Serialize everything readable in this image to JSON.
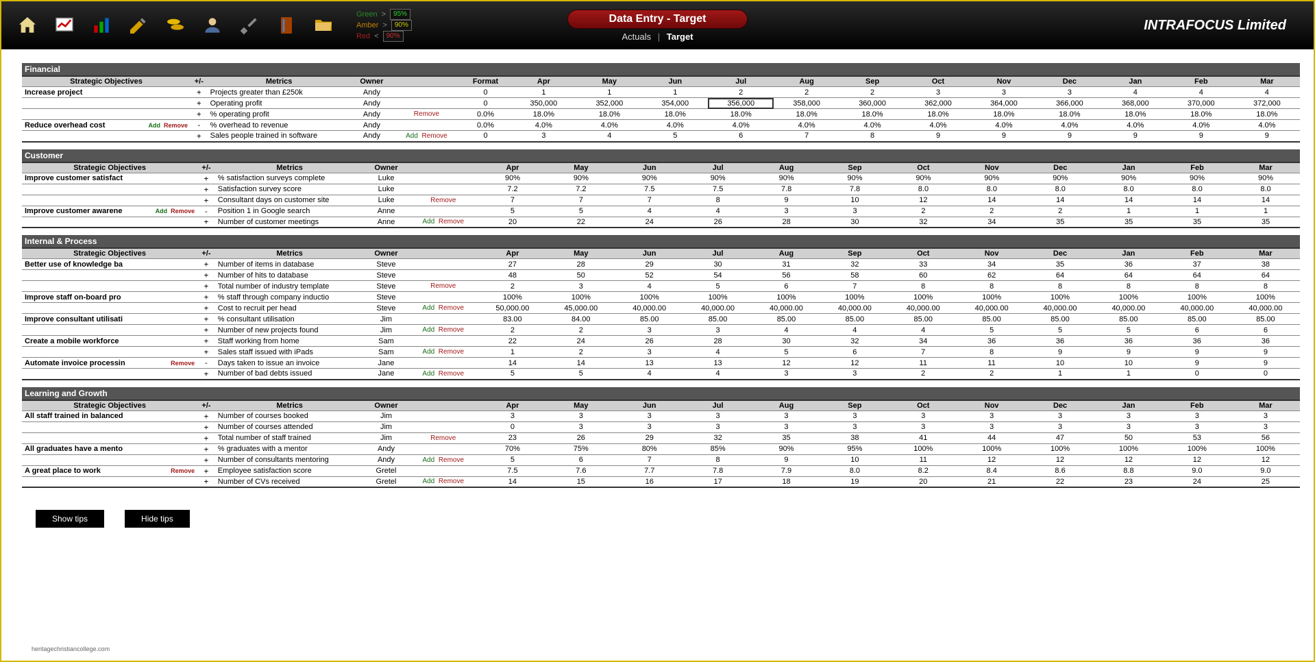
{
  "header": {
    "title": "Data Entry - Target",
    "tab_actuals": "Actuals",
    "tab_target": "Target",
    "company": "INTRAFOCUS Limited",
    "legend": {
      "green_label": "Green",
      "green_op": ">",
      "green_val": "95%",
      "amber_label": "Amber",
      "amber_op": ">",
      "amber_val": "90%",
      "red_label": "Red",
      "red_op": "<",
      "red_val": "90%"
    }
  },
  "buttons": {
    "show_tips": "Show tips",
    "hide_tips": "Hide tips"
  },
  "watermark": "heritagechristiancollege.com",
  "columns": {
    "strategic_objectives": "Strategic Objectives",
    "plus_minus": "+/-",
    "metrics": "Metrics",
    "owner": "Owner",
    "format": "Format",
    "months": [
      "Apr",
      "May",
      "Jun",
      "Jul",
      "Aug",
      "Sep",
      "Oct",
      "Nov",
      "Dec",
      "Jan",
      "Feb",
      "Mar"
    ]
  },
  "labels": {
    "add": "Add",
    "remove": "Remove"
  },
  "selected": {
    "section": 0,
    "row": 1,
    "col": 3
  },
  "sections": [
    {
      "name": "Financial",
      "objectives": [
        {
          "name": "Increase project",
          "obj_actions": "",
          "rows": [
            {
              "pm": "+",
              "metric": "Projects greater than £250k",
              "owner": "Andy",
              "actions": "",
              "format": "0",
              "values": [
                "1",
                "1",
                "1",
                "2",
                "2",
                "2",
                "3",
                "3",
                "3",
                "4",
                "4",
                "4"
              ]
            },
            {
              "pm": "+",
              "metric": "Operating profit",
              "owner": "Andy",
              "actions": "",
              "format": "0",
              "values": [
                "350,000",
                "352,000",
                "354,000",
                "356,000",
                "358,000",
                "360,000",
                "362,000",
                "364,000",
                "366,000",
                "368,000",
                "370,000",
                "372,000"
              ]
            },
            {
              "pm": "+",
              "metric": "% operating profit",
              "owner": "Andy",
              "actions": "Remove",
              "format": "0.0%",
              "values": [
                "18.0%",
                "18.0%",
                "18.0%",
                "18.0%",
                "18.0%",
                "18.0%",
                "18.0%",
                "18.0%",
                "18.0%",
                "18.0%",
                "18.0%",
                "18.0%"
              ]
            }
          ]
        },
        {
          "name": "Reduce overhead cost",
          "obj_actions": "Add Remove",
          "rows": [
            {
              "pm": "-",
              "metric": "% overhead to revenue",
              "owner": "Andy",
              "actions": "",
              "format": "0.0%",
              "values": [
                "4.0%",
                "4.0%",
                "4.0%",
                "4.0%",
                "4.0%",
                "4.0%",
                "4.0%",
                "4.0%",
                "4.0%",
                "4.0%",
                "4.0%",
                "4.0%"
              ]
            },
            {
              "pm": "+",
              "metric": "Sales people trained in software",
              "owner": "Andy",
              "actions": "Add Remove",
              "format": "0",
              "values": [
                "3",
                "4",
                "5",
                "6",
                "7",
                "8",
                "9",
                "9",
                "9",
                "9",
                "9",
                "9"
              ]
            }
          ]
        }
      ]
    },
    {
      "name": "Customer",
      "objectives": [
        {
          "name": "Improve customer satisfact",
          "obj_actions": "",
          "rows": [
            {
              "pm": "+",
              "metric": "% satisfaction surveys complete",
              "owner": "Luke",
              "actions": "",
              "format": "",
              "values": [
                "90%",
                "90%",
                "90%",
                "90%",
                "90%",
                "90%",
                "90%",
                "90%",
                "90%",
                "90%",
                "90%",
                "90%"
              ]
            },
            {
              "pm": "+",
              "metric": "Satisfaction survey score",
              "owner": "Luke",
              "actions": "",
              "format": "0.0",
              "values": [
                "7.2",
                "7.2",
                "7.5",
                "7.5",
                "7.8",
                "7.8",
                "8.0",
                "8.0",
                "8.0",
                "8.0",
                "8.0",
                "8.0"
              ]
            },
            {
              "pm": "+",
              "metric": "Consultant days on customer site",
              "owner": "Luke",
              "actions": "Remove",
              "format": "0",
              "values": [
                "7",
                "7",
                "7",
                "8",
                "9",
                "10",
                "12",
                "14",
                "14",
                "14",
                "14",
                "14"
              ]
            }
          ]
        },
        {
          "name": "Improve customer awarene",
          "obj_actions": "Add Remove",
          "rows": [
            {
              "pm": "-",
              "metric": "Position 1 in Google search",
              "owner": "Anne",
              "actions": "",
              "format": "0",
              "values": [
                "5",
                "5",
                "4",
                "4",
                "3",
                "3",
                "2",
                "2",
                "2",
                "1",
                "1",
                "1"
              ]
            },
            {
              "pm": "+",
              "metric": "Number of customer meetings",
              "owner": "Anne",
              "actions": "Add Remove",
              "format": "0",
              "values": [
                "20",
                "22",
                "24",
                "26",
                "28",
                "30",
                "32",
                "34",
                "35",
                "35",
                "35",
                "35"
              ]
            }
          ]
        }
      ]
    },
    {
      "name": "Internal & Process",
      "objectives": [
        {
          "name": "Better use of knowledge ba",
          "obj_actions": "",
          "rows": [
            {
              "pm": "+",
              "metric": "Number of items in database",
              "owner": "Steve",
              "actions": "",
              "format": "0",
              "values": [
                "27",
                "28",
                "29",
                "30",
                "31",
                "32",
                "33",
                "34",
                "35",
                "36",
                "37",
                "38"
              ]
            },
            {
              "pm": "+",
              "metric": "Number of hits to database",
              "owner": "Steve",
              "actions": "",
              "format": "0",
              "values": [
                "48",
                "50",
                "52",
                "54",
                "56",
                "58",
                "60",
                "62",
                "64",
                "64",
                "64",
                "64"
              ]
            },
            {
              "pm": "+",
              "metric": "Total number of industry template",
              "owner": "Steve",
              "actions": "Remove",
              "format": "0",
              "values": [
                "2",
                "3",
                "4",
                "5",
                "6",
                "7",
                "8",
                "8",
                "8",
                "8",
                "8",
                "8"
              ]
            }
          ]
        },
        {
          "name": "Improve staff on-board pro",
          "obj_actions": "",
          "rows": [
            {
              "pm": "+",
              "metric": "% staff through company inductio",
              "owner": "Steve",
              "actions": "",
              "format": "0%",
              "values": [
                "100%",
                "100%",
                "100%",
                "100%",
                "100%",
                "100%",
                "100%",
                "100%",
                "100%",
                "100%",
                "100%",
                "100%"
              ]
            },
            {
              "pm": "+",
              "metric": "Cost to recruit per head",
              "owner": "Steve",
              "actions": "Add Remove",
              "format": "0.00",
              "values": [
                "50,000.00",
                "45,000.00",
                "40,000.00",
                "40,000.00",
                "40,000.00",
                "40,000.00",
                "40,000.00",
                "40,000.00",
                "40,000.00",
                "40,000.00",
                "40,000.00",
                "40,000.00"
              ]
            }
          ]
        },
        {
          "name": "Improve consultant utilisati",
          "obj_actions": "",
          "rows": [
            {
              "pm": "+",
              "metric": "% consultant utilisation",
              "owner": "Jim",
              "actions": "",
              "format": "0.0%",
              "values": [
                "83.00",
                "84.00",
                "85.00",
                "85.00",
                "85.00",
                "85.00",
                "85.00",
                "85.00",
                "85.00",
                "85.00",
                "85.00",
                "85.00"
              ]
            },
            {
              "pm": "+",
              "metric": "Number of new projects found",
              "owner": "Jim",
              "actions": "Add Remove",
              "format": "0",
              "values": [
                "2",
                "2",
                "3",
                "3",
                "4",
                "4",
                "4",
                "5",
                "5",
                "5",
                "6",
                "6"
              ]
            }
          ]
        },
        {
          "name": "Create a mobile workforce",
          "obj_actions": "",
          "rows": [
            {
              "pm": "+",
              "metric": "Staff working from home",
              "owner": "Sam",
              "actions": "",
              "format": "0",
              "values": [
                "22",
                "24",
                "26",
                "28",
                "30",
                "32",
                "34",
                "36",
                "36",
                "36",
                "36",
                "36"
              ]
            },
            {
              "pm": "+",
              "metric": "Sales staff issued with iPads",
              "owner": "Sam",
              "actions": "Add Remove",
              "format": "0",
              "values": [
                "1",
                "2",
                "3",
                "4",
                "5",
                "6",
                "7",
                "8",
                "9",
                "9",
                "9",
                "9"
              ]
            }
          ]
        },
        {
          "name": "Automate invoice processin",
          "obj_actions": "Remove",
          "rows": [
            {
              "pm": "-",
              "metric": "Days taken to issue an invoice",
              "owner": "Jane",
              "actions": "",
              "format": "0",
              "values": [
                "14",
                "14",
                "13",
                "13",
                "12",
                "12",
                "11",
                "11",
                "10",
                "10",
                "9",
                "9"
              ]
            },
            {
              "pm": "+",
              "metric": "Number of bad debts issued",
              "owner": "Jane",
              "actions": "Add Remove",
              "format": "0",
              "values": [
                "5",
                "5",
                "4",
                "4",
                "3",
                "3",
                "2",
                "2",
                "1",
                "1",
                "0",
                "0"
              ]
            }
          ]
        }
      ]
    },
    {
      "name": "Learning and Growth",
      "objectives": [
        {
          "name": "All staff trained in balanced",
          "obj_actions": "",
          "rows": [
            {
              "pm": "+",
              "metric": "Number of courses booked",
              "owner": "Jim",
              "actions": "",
              "format": "0",
              "values": [
                "3",
                "3",
                "3",
                "3",
                "3",
                "3",
                "3",
                "3",
                "3",
                "3",
                "3",
                "3"
              ]
            },
            {
              "pm": "+",
              "metric": "Number of courses attended",
              "owner": "Jim",
              "actions": "",
              "format": "0",
              "values": [
                "0",
                "3",
                "3",
                "3",
                "3",
                "3",
                "3",
                "3",
                "3",
                "3",
                "3",
                "3"
              ]
            },
            {
              "pm": "+",
              "metric": "Total number of staff trained",
              "owner": "Jim",
              "actions": "Remove",
              "format": "0",
              "values": [
                "23",
                "26",
                "29",
                "32",
                "35",
                "38",
                "41",
                "44",
                "47",
                "50",
                "53",
                "56"
              ]
            }
          ]
        },
        {
          "name": "All graduates have a mento",
          "obj_actions": "",
          "rows": [
            {
              "pm": "+",
              "metric": "% graduates with a mentor",
              "owner": "Andy",
              "actions": "",
              "format": "0%",
              "values": [
                "70%",
                "75%",
                "80%",
                "85%",
                "90%",
                "95%",
                "100%",
                "100%",
                "100%",
                "100%",
                "100%",
                "100%"
              ]
            },
            {
              "pm": "+",
              "metric": "Number of consultants mentoring",
              "owner": "Andy",
              "actions": "Add Remove",
              "format": "0",
              "values": [
                "5",
                "6",
                "7",
                "8",
                "9",
                "10",
                "11",
                "12",
                "12",
                "12",
                "12",
                "12"
              ]
            }
          ]
        },
        {
          "name": "A great place to work",
          "obj_actions": "Remove",
          "rows": [
            {
              "pm": "+",
              "metric": "Employee satisfaction score",
              "owner": "Gretel",
              "actions": "",
              "format": "0.0",
              "values": [
                "7.5",
                "7.6",
                "7.7",
                "7.8",
                "7.9",
                "8.0",
                "8.2",
                "8.4",
                "8.6",
                "8.8",
                "9.0",
                "9.0"
              ]
            },
            {
              "pm": "+",
              "metric": "Number of CVs received",
              "owner": "Gretel",
              "actions": "Add Remove",
              "format": "0",
              "values": [
                "14",
                "15",
                "16",
                "17",
                "18",
                "19",
                "20",
                "21",
                "22",
                "23",
                "24",
                "25"
              ]
            }
          ]
        }
      ]
    }
  ]
}
